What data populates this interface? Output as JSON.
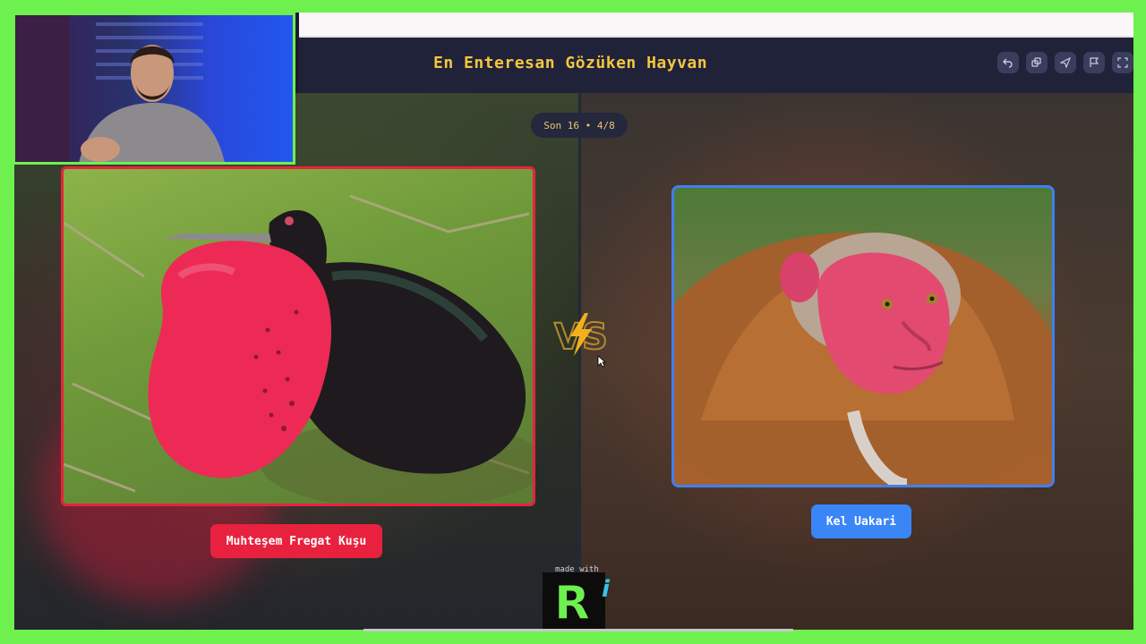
{
  "app": {
    "title": "En Enteresan Gözüken Hayvan",
    "round_badge": "Son 16 • 4/8",
    "toolbar_icons": [
      "undo-icon",
      "copy-icon",
      "send-icon",
      "flag-icon",
      "fullscreen-icon"
    ]
  },
  "matchup": {
    "left": {
      "label": "Muhteşem Fregat Kuşu",
      "accent": "#e8223e"
    },
    "right": {
      "label": "Kel Uakari",
      "accent": "#3a86f7"
    },
    "vs_text": "VS"
  },
  "footer": {
    "made_with": "made with",
    "logo_letter": "R",
    "logo_suffix": "i"
  },
  "colors": {
    "frame_border": "#6ef04f",
    "title": "#f4c63d"
  }
}
